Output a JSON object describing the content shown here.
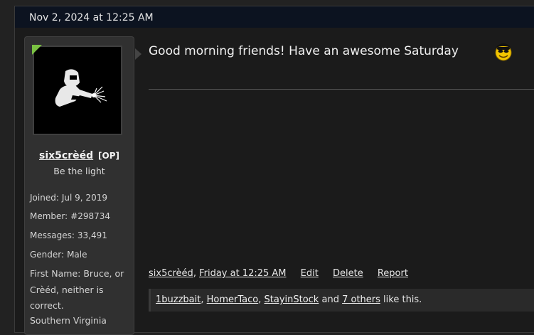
{
  "post": {
    "date": "Nov 2, 2024 at 12:25 AM",
    "message": "Good morning friends! Have an awesome Saturday",
    "emoji_icon": "smiling-sunglasses-emoji-icon"
  },
  "user": {
    "username": "six5crèéd",
    "op_badge": "[OP]",
    "title": "Be the light",
    "online": true,
    "avatar_icon": "welder-avatar-icon",
    "stats": [
      {
        "label": "Joined:",
        "value": "Jul 9, 2019"
      },
      {
        "label": "Member:",
        "value": "#298734"
      },
      {
        "label": "Messages:",
        "value": "33,491"
      },
      {
        "label": "Gender:",
        "value": "Male"
      }
    ],
    "first_name": "First Name: Bruce, or Crèéd, neither is correct.",
    "location": "Southern Virginia"
  },
  "actions": {
    "author": "six5crèéd",
    "timestamp": "Friday at 12:25 AM",
    "edit": "Edit",
    "delete": "Delete",
    "report": "Report"
  },
  "likes": {
    "users": [
      "1buzzbait",
      "HomerTaco",
      "StayinStock"
    ],
    "sep1": ",",
    "sep2": ",",
    "and": "and",
    "others": "7 others",
    "suffix": "like this."
  },
  "colors": {
    "online_indicator": "#7ac142",
    "header_bg": "#0c1320"
  }
}
